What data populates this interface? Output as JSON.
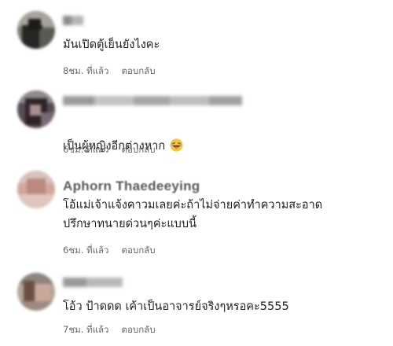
{
  "comments": [
    {
      "text": "มันเปิดตู้เย็นยังไงคะ",
      "time": "8ชม. ที่แล้ว",
      "reply": "ตอบกลับ"
    },
    {
      "text": "เป็นผู้หญิงอีกต่างหาก",
      "emoji": "laughing-emoji",
      "time": "6ชม. ที่แล้ว",
      "reply": "ตอบกลับ"
    },
    {
      "name": "Aphorn Thaedeeying",
      "text": "โอ้แม่เจ้าแจ้งคาวมเลยค่ะถ้าไม่จ่ายค่าทำความสะอาด\nปรึกษาทนายด่วนๆค่ะแบบนี้",
      "time": "6ชม. ที่แล้ว",
      "reply": "ตอบกลับ"
    },
    {
      "text": "โอ้ว ป้าดดด เค้าเป็นอาจารย์จริงๆหรอคะ5555",
      "time": "7ชม. ที่แล้ว",
      "reply": "ตอบกลับ"
    }
  ]
}
